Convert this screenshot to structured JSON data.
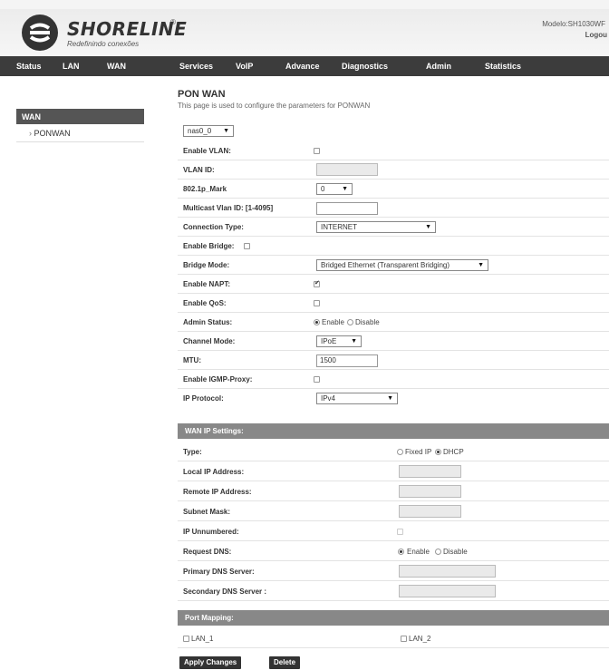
{
  "header": {
    "brand": "SHORELINE",
    "registered": "®",
    "tagline": "Redefinindo conexões",
    "model": "Modelo:SH1030WF",
    "logout": "Logou"
  },
  "nav": [
    "Status",
    "LAN",
    "WAN",
    "Services",
    "VoIP",
    "Advance",
    "Diagnostics",
    "Admin",
    "Statistics"
  ],
  "sidebar": {
    "category": "WAN",
    "items": [
      "PONWAN"
    ]
  },
  "page": {
    "title": "PON WAN",
    "description": "This page is used to configure the parameters for PONWAN",
    "interface_select": "nas0_0"
  },
  "form": {
    "enable_vlan": {
      "label": "Enable VLAN:",
      "checked": false
    },
    "vlan_id": {
      "label": "VLAN ID:",
      "value": ""
    },
    "mark_8021p": {
      "label": "802.1p_Mark",
      "value": "0"
    },
    "multicast_vlan": {
      "label": "Multicast Vlan ID: [1-4095]",
      "value": ""
    },
    "connection_type": {
      "label": "Connection Type:",
      "value": "INTERNET"
    },
    "enable_bridge": {
      "label": "Enable Bridge:",
      "checked": false
    },
    "bridge_mode": {
      "label": "Bridge Mode:",
      "value": "Bridged Ethernet (Transparent Bridging)"
    },
    "enable_napt": {
      "label": "Enable NAPT:",
      "checked": true
    },
    "enable_qos": {
      "label": "Enable QoS:",
      "checked": false
    },
    "admin_status": {
      "label": "Admin Status:",
      "enable": "Enable",
      "disable": "Disable",
      "selected": "Enable"
    },
    "channel_mode": {
      "label": "Channel Mode:",
      "value": "IPoE"
    },
    "mtu": {
      "label": "MTU:",
      "value": "1500"
    },
    "igmp_proxy": {
      "label": "Enable IGMP-Proxy:",
      "checked": false
    },
    "ip_protocol": {
      "label": "IP Protocol:",
      "value": "IPv4"
    }
  },
  "wan_ip": {
    "header": "WAN IP Settings:",
    "type": {
      "label": "Type:",
      "fixed": "Fixed IP",
      "dhcp": "DHCP",
      "selected": "DHCP"
    },
    "local_ip": {
      "label": "Local IP Address:",
      "value": ""
    },
    "remote_ip": {
      "label": "Remote IP Address:",
      "value": ""
    },
    "subnet_mask": {
      "label": "Subnet Mask:",
      "value": ""
    },
    "ip_unnumbered": {
      "label": "IP Unnumbered:",
      "checked": false
    },
    "request_dns": {
      "label": "Request DNS:",
      "enable": "Enable",
      "disable": "Disable",
      "selected": "Enable"
    },
    "primary_dns": {
      "label": "Primary DNS Server:",
      "value": ""
    },
    "secondary_dns": {
      "label": "Secondary DNS Server :",
      "value": ""
    }
  },
  "port_mapping": {
    "header": "Port Mapping:",
    "ports": [
      "LAN_1",
      "LAN_2"
    ]
  },
  "buttons": {
    "apply": "Apply Changes",
    "delete": "Delete"
  },
  "colors": {
    "nav_bg": "#3c3c3c",
    "section_bg": "#888888",
    "button_bg": "#333333"
  }
}
